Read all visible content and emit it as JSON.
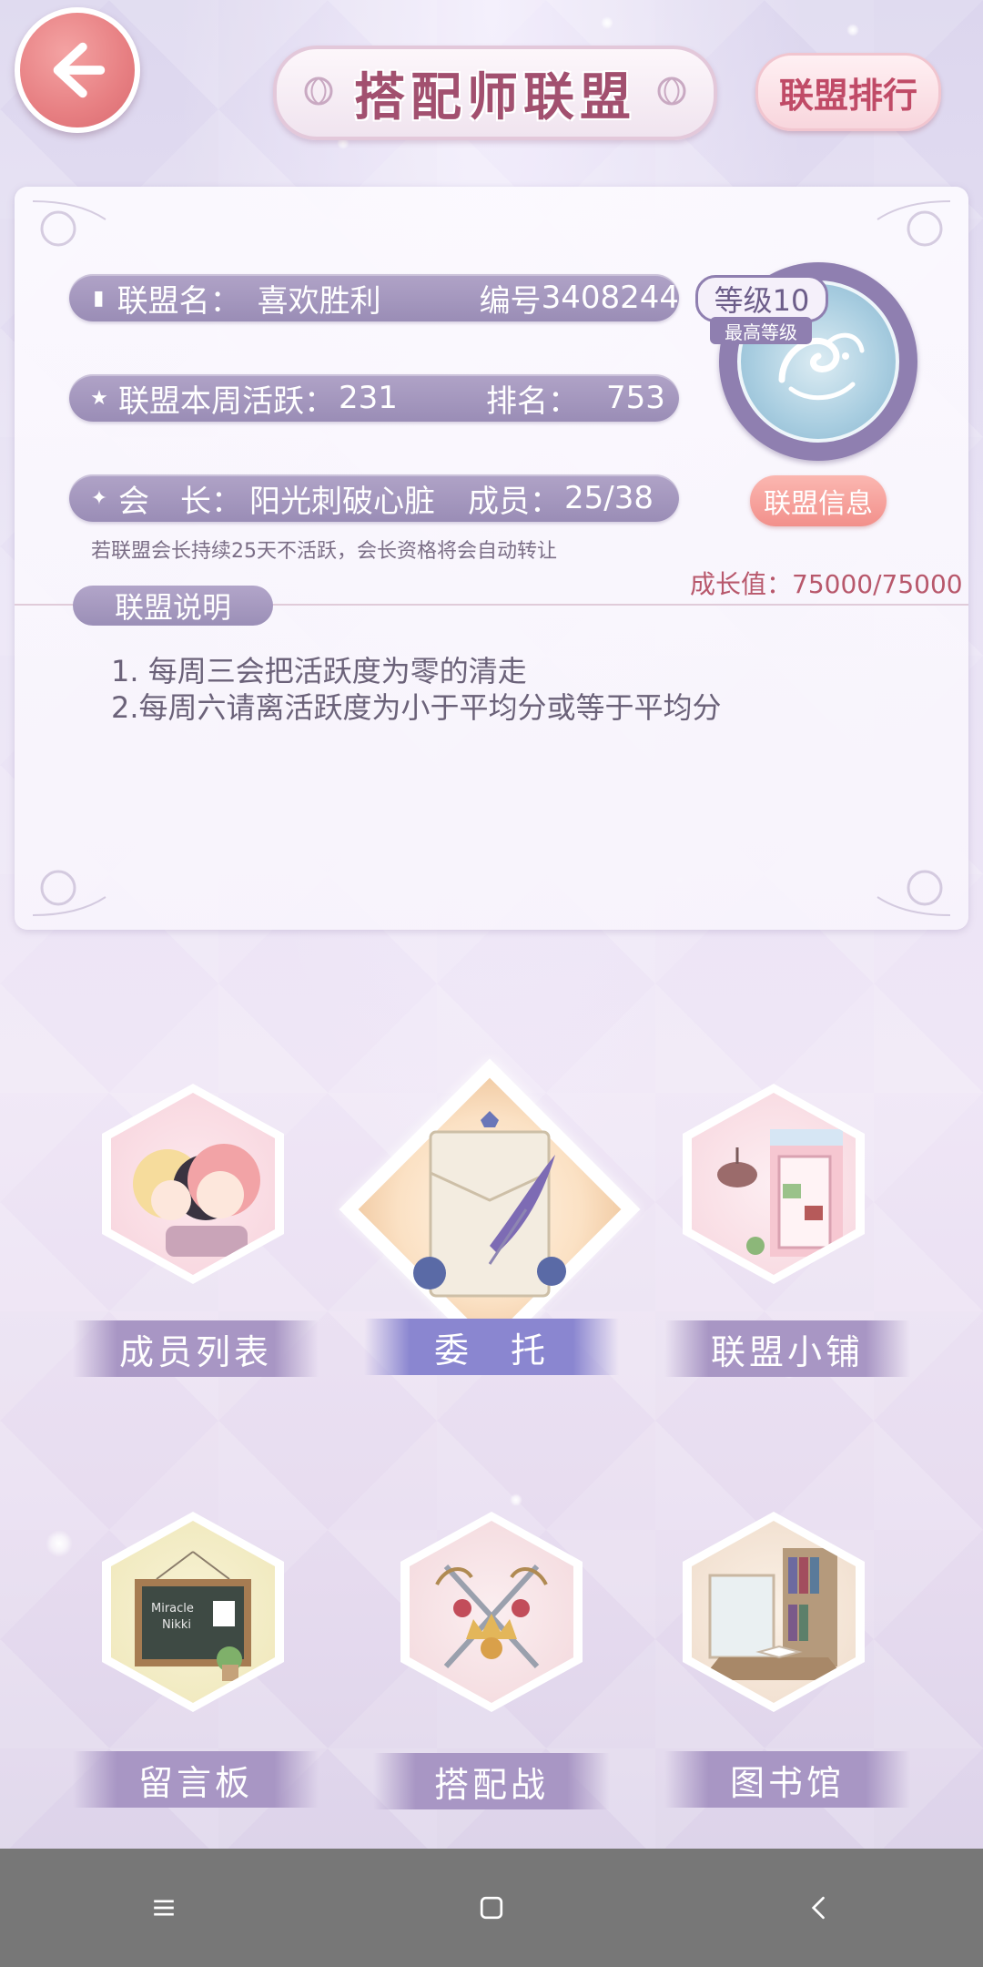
{
  "header": {
    "title": "搭配师联盟",
    "rank_button": "联盟排行"
  },
  "alliance": {
    "name_label": "联盟名：",
    "name_value": "喜欢胜利",
    "id_label": "编号",
    "id_value": "3408244",
    "weekly_label": "联盟本周活跃：",
    "weekly_value": "231",
    "rank_label": "排名：",
    "rank_value": "753",
    "leader_label": "会　长：",
    "leader_value": "阳光刺破心脏",
    "members_label": "成员：",
    "members_value": "25/38",
    "notice": "若联盟会长持续25天不活跃，会长资格将会自动转让",
    "growth": "成长值：75000/75000",
    "level": "等级10",
    "max_level": "最高等级",
    "info_button": "联盟信息"
  },
  "description": {
    "label": "联盟说明",
    "lines": [
      "1. 每周三会把活跃度为零的清走",
      "2.每周六请离活跃度为小于平均分或等于平均分"
    ]
  },
  "features": [
    {
      "label": "成员列表",
      "icon": "members-illustration"
    },
    {
      "label": "委　托",
      "icon": "commission-envelope-illustration"
    },
    {
      "label": "联盟小铺",
      "icon": "shop-illustration"
    },
    {
      "label": "留言板",
      "icon": "message-board-illustration"
    },
    {
      "label": "搭配战",
      "icon": "battle-crest-illustration"
    },
    {
      "label": "图书馆",
      "icon": "library-illustration"
    }
  ],
  "colors": {
    "accent_pink": "#e77f82",
    "title_rose": "#a2506f",
    "pill_lavender": "#9a8db6",
    "growth_red": "#b8586c"
  },
  "navbar": {
    "icons": [
      "menu-icon",
      "home-square-icon",
      "back-chevron-icon"
    ]
  }
}
